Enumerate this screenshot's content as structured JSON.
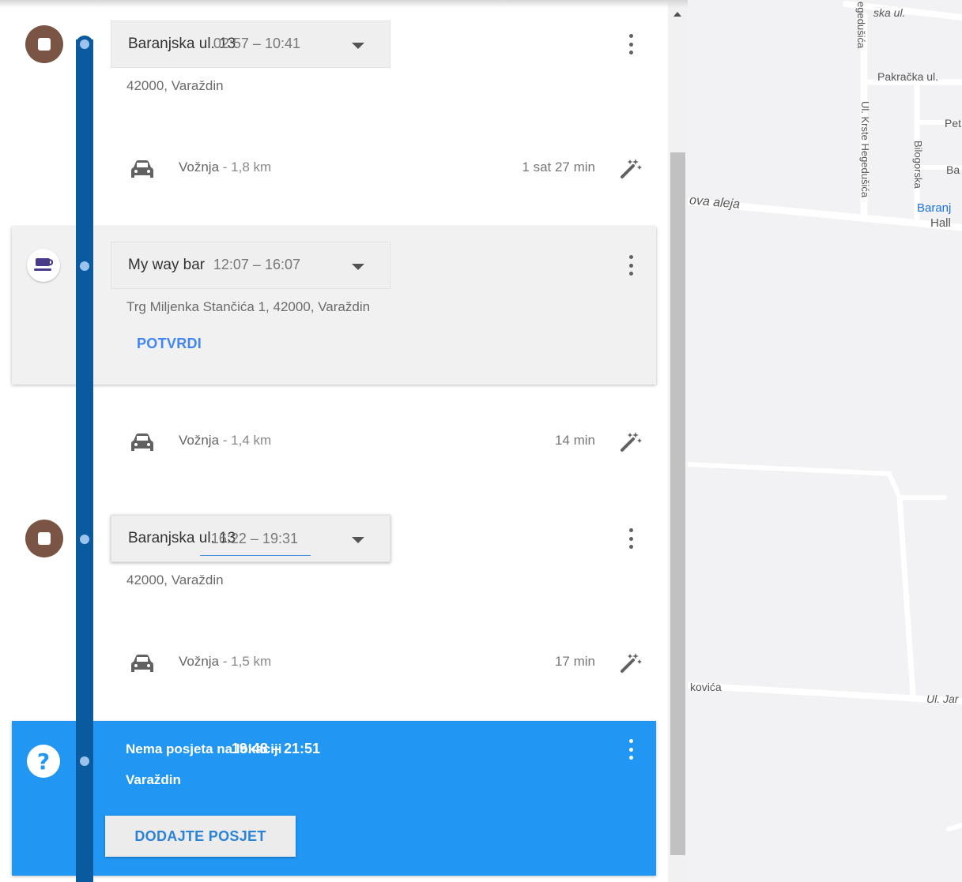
{
  "timeline": {
    "visit1": {
      "place": "Baranjska ul. 13",
      "address": "42000, Varaždin",
      "time": "02:57 – 10:41",
      "icon": "home-icon"
    },
    "drive1": {
      "mode": "Vožnja",
      "distance": "- 1,8 km",
      "duration": "1 sat 27 min"
    },
    "visit2": {
      "place": "My way bar",
      "address": "Trg Miljenka Stančića 1, 42000, Varaždin",
      "time": "12:07 – 16:07",
      "icon": "cafe-icon",
      "confirm_label": "POTVRDI"
    },
    "drive2": {
      "mode": "Vožnja",
      "distance": "- 1,4 km",
      "duration": "14 min"
    },
    "visit3": {
      "place": "Baranjska ul. 13",
      "address": "42000, Varaždin",
      "time": "16:22 – 19:31",
      "icon": "home-icon"
    },
    "drive3": {
      "mode": "Vožnja",
      "distance": "- 1,5 km",
      "duration": "17 min"
    },
    "unknown_visit": {
      "title": "Nema posjeta na lokaciji",
      "subtitle": "Varaždin",
      "time": "19:48 – 21:51",
      "icon": "question-icon",
      "add_label": "DODAJTE POSJET"
    }
  },
  "map": {
    "labels": {
      "street_top": "ska ul.",
      "hegedusica_top": "egedušića",
      "pakracka": "Pakračka ul.",
      "pet": "Pet",
      "krste": "Ul. Krste Hegedušića",
      "bilogorska": "Bilogorska",
      "ba": "Ba",
      "aleja": "ova aleja",
      "baranj": "Baranj",
      "hall": "Hall",
      "kovica": "kovića",
      "ul_jar": "Ul. Jar"
    },
    "colors": {
      "background": "#f2f2f4",
      "road": "#ffffff",
      "poi_text": "#1a73e8"
    }
  },
  "colors": {
    "route": "#0a5aa0",
    "home_marker": "#7a5545",
    "highlight_card": "#2196f3",
    "link": "#4285f4"
  }
}
